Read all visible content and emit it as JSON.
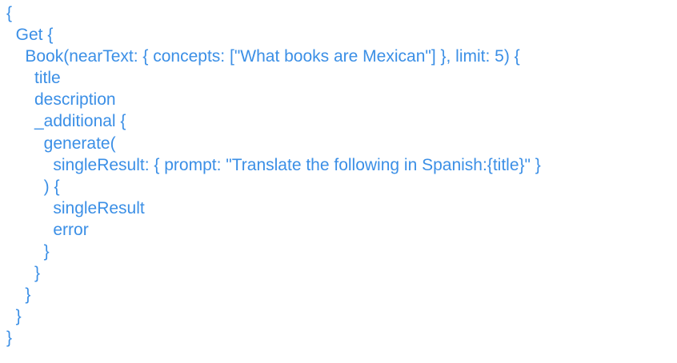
{
  "code": {
    "lines": [
      "{",
      "  Get {",
      "    Book(nearText: { concepts: [\"What books are Mexican\"] }, limit: 5) {",
      "      title",
      "      description",
      "      _additional {",
      "        generate(",
      "          singleResult: { prompt: \"Translate the following in Spanish:{title}\" }",
      "        ) {",
      "          singleResult",
      "          error",
      "        }",
      "      }",
      "    }",
      "  }",
      "}"
    ]
  },
  "colors": {
    "text": "#3b8fe6",
    "background": "#ffffff"
  }
}
